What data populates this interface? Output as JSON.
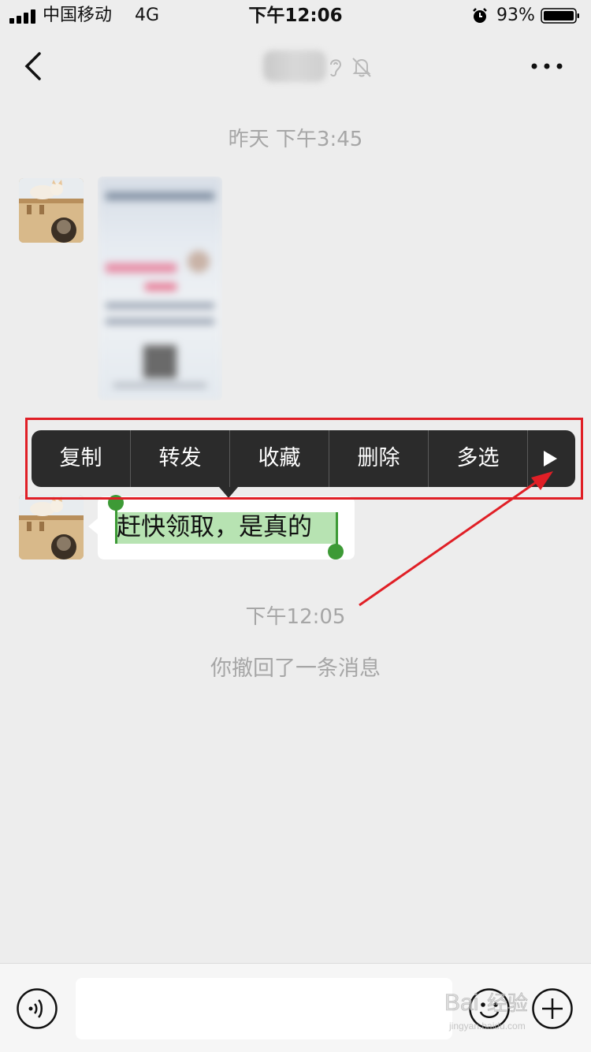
{
  "status_bar": {
    "carrier": "中国移动",
    "network": "4G",
    "time": "下午12:06",
    "battery": "93%",
    "icons": [
      "signal-icon",
      "alarm-icon",
      "battery-icon"
    ]
  },
  "nav": {
    "icons": [
      "back-icon",
      "ear-icon",
      "mute-icon",
      "more-icon"
    ]
  },
  "chat": {
    "timestamp_1": "昨天 下午3:45",
    "text_message": "赶快领取，是真的",
    "timestamp_2": "下午12:05",
    "recall_notice": "你撤回了一条消息"
  },
  "context_menu": {
    "items": [
      "复制",
      "转发",
      "收藏",
      "删除",
      "多选"
    ],
    "next_icon": "play-triangle-icon"
  },
  "input_bar": {
    "value": "",
    "icons": [
      "voice-icon",
      "emoji-icon",
      "plus-icon"
    ]
  },
  "colors": {
    "background": "#ededed",
    "menu_bg": "#2b2b2b",
    "selection": "#b7e3b2",
    "selection_handle": "#3d9a36",
    "annotation_red": "#e01f26"
  },
  "watermark": "Baidu 经验"
}
